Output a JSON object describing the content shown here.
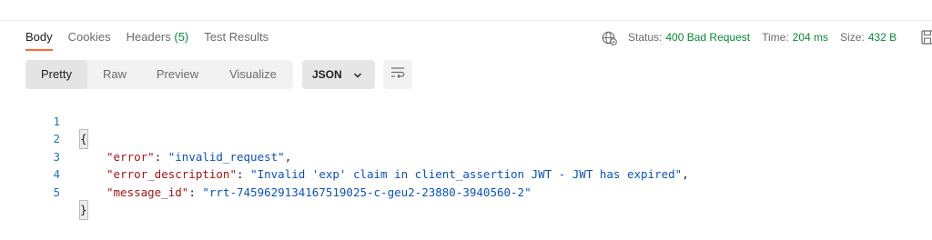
{
  "tabs": [
    {
      "label": "Body"
    },
    {
      "label": "Cookies"
    },
    {
      "label": "Headers",
      "count": "(5)"
    },
    {
      "label": "Test Results"
    }
  ],
  "status": {
    "status_label": "Status:",
    "status_value": "400 Bad Request",
    "time_label": "Time:",
    "time_value": "204 ms",
    "size_label": "Size:",
    "size_value": "432 B"
  },
  "view_modes": [
    "Pretty",
    "Raw",
    "Preview",
    "Visualize"
  ],
  "format": {
    "selected": "JSON"
  },
  "code": {
    "line_numbers": [
      "1",
      "2",
      "3",
      "4",
      "5"
    ],
    "open_brace": "{",
    "close_brace": "}",
    "entries": [
      {
        "key": "\"error\"",
        "value": "\"invalid_request\"",
        "comma": ","
      },
      {
        "key": "\"error_description\"",
        "value": "\"Invalid 'exp' claim in client_assertion JWT - JWT has expired\"",
        "comma": ","
      },
      {
        "key": "\"message_id\"",
        "value": "\"rrt-7459629134167519025-c-geu2-23880-3940560-2\"",
        "comma": ""
      }
    ],
    "colon": ": "
  },
  "colors": {
    "accent": "#ff6c37",
    "success": "#0b8a3a",
    "line_number": "#1a75c9",
    "json_key": "#a31515",
    "json_string": "#0b51c1"
  },
  "icons": {
    "network": "globe-icon",
    "save": "save-icon",
    "format_dropdown": "chevron-down-icon",
    "wrap": "wrap-lines-icon"
  }
}
